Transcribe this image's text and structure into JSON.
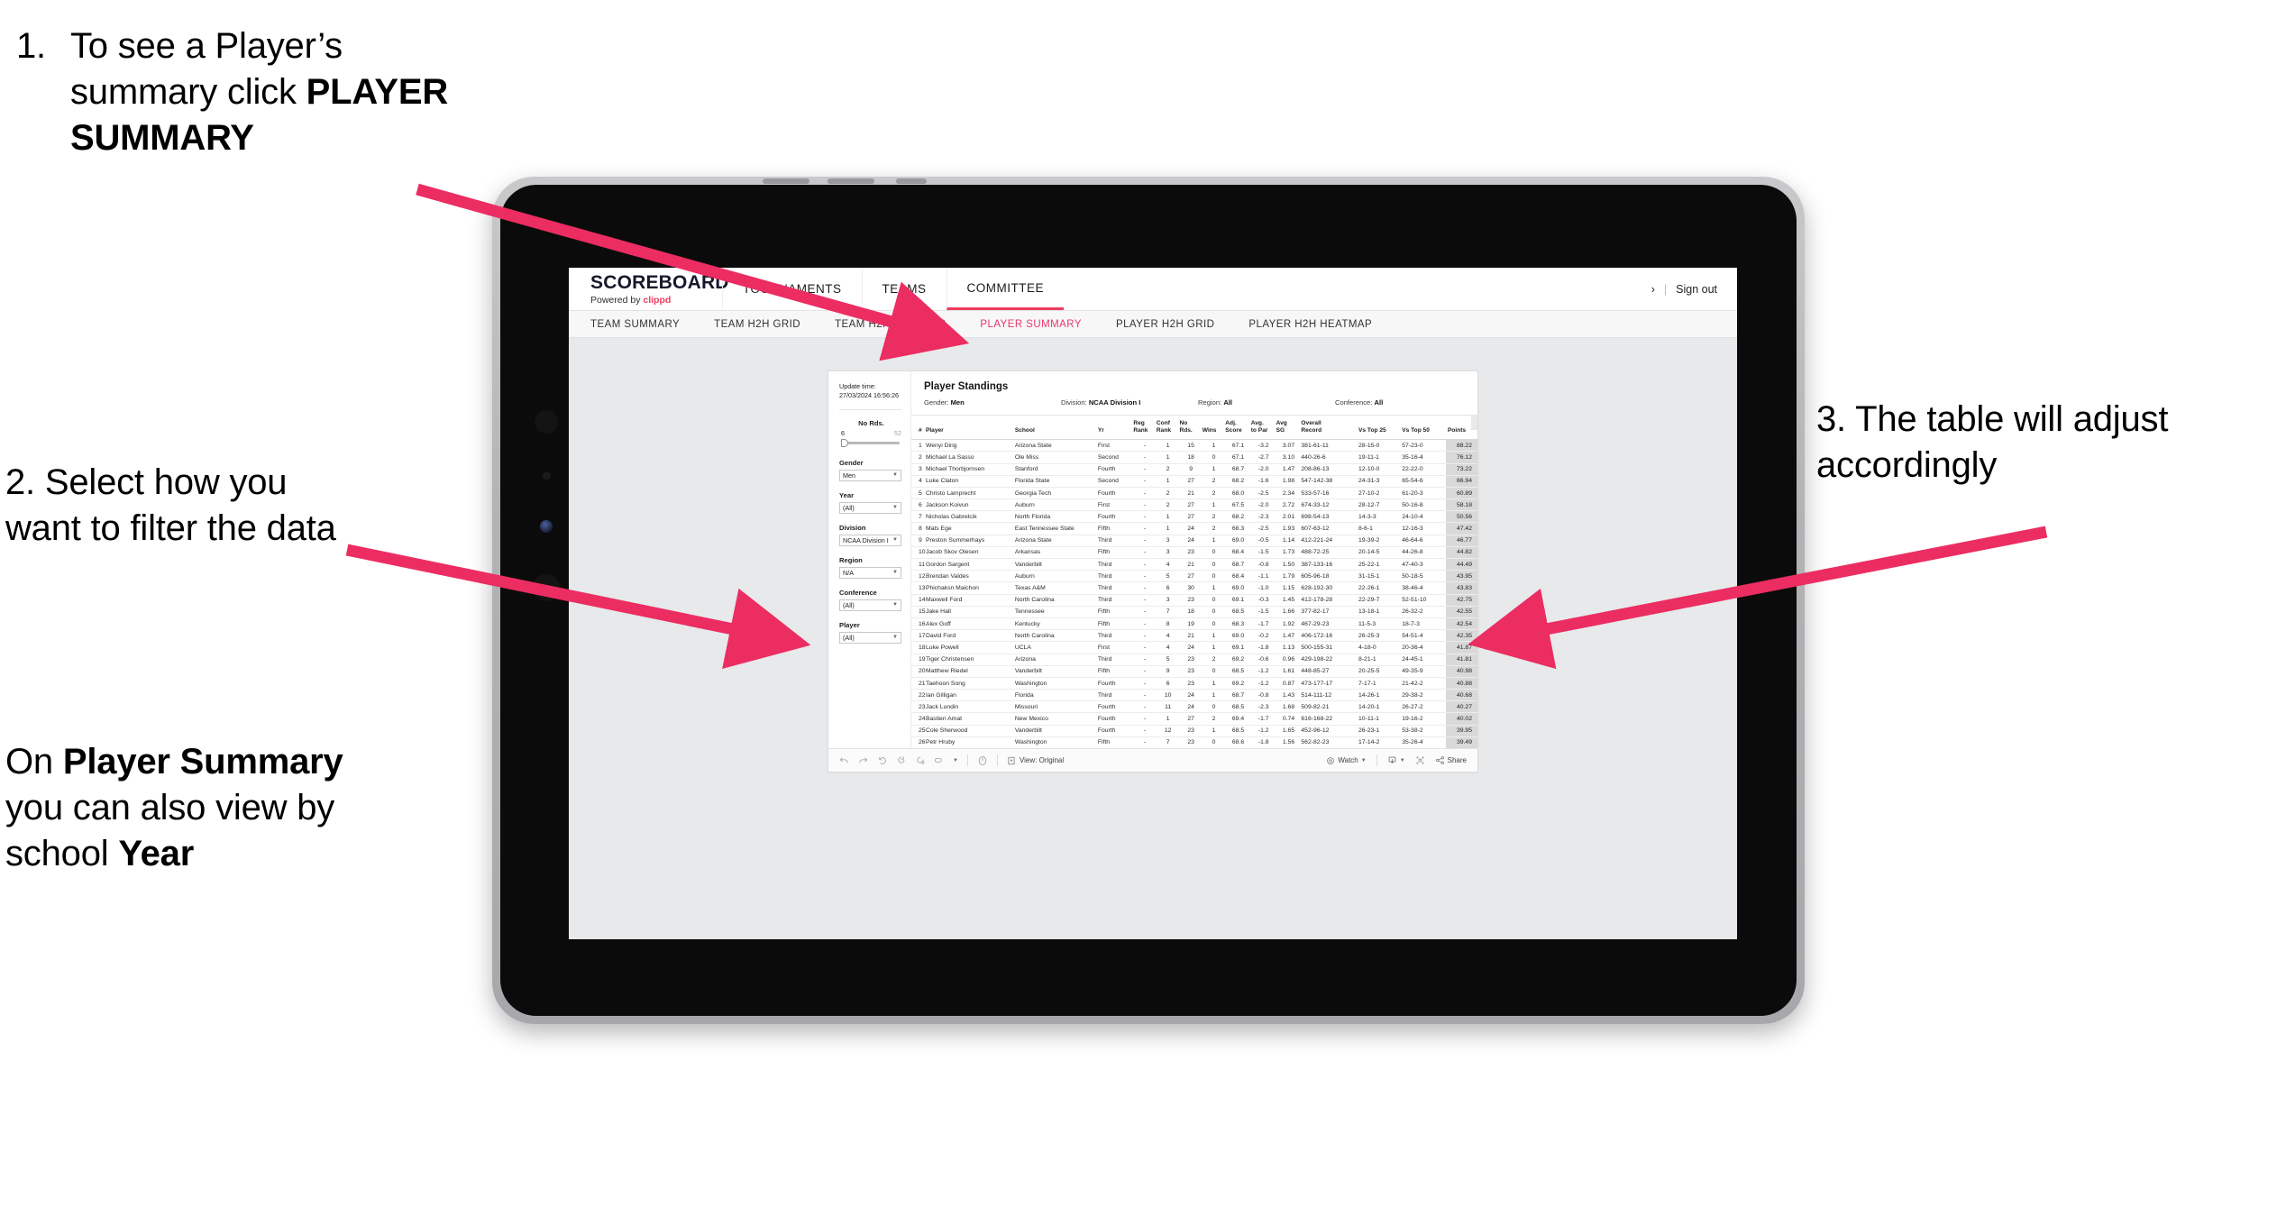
{
  "annotations": {
    "step1": {
      "number": "1.",
      "text_before": "To see a Player’s summary click ",
      "bold": "PLAYER SUMMARY"
    },
    "step2": {
      "text": "2. Select how you want to filter the data"
    },
    "step2b": {
      "before": "On ",
      "bold1": "Player Summary",
      "middle": " you can also view by school ",
      "bold2": "Year"
    },
    "step3": {
      "text": "3. The table will adjust accordingly"
    },
    "arrow_color": "#ec2d62"
  },
  "app": {
    "logo": {
      "title": "SCOREBOARD",
      "powered_prefix": "Powered by ",
      "brand": "clippd"
    },
    "top_tabs": [
      {
        "label": "TOURNAMENTS",
        "active": false
      },
      {
        "label": "TEAMS",
        "active": false
      },
      {
        "label": "COMMITTEE",
        "active": true
      }
    ],
    "header_right": {
      "chevron": "›",
      "separator": "|",
      "sign_out": "Sign out"
    },
    "sub_tabs": [
      {
        "label": "TEAM SUMMARY",
        "active": false
      },
      {
        "label": "TEAM H2H GRID",
        "active": false
      },
      {
        "label": "TEAM H2H HEATMAP",
        "active": false
      },
      {
        "label": "PLAYER SUMMARY",
        "active": true
      },
      {
        "label": "PLAYER H2H GRID",
        "active": false
      },
      {
        "label": "PLAYER H2H HEATMAP",
        "active": false
      }
    ],
    "accent_color": "#ee3b5f"
  },
  "filters": {
    "update_time_label": "Update time:",
    "update_time_value": "27/03/2024 16:56:26",
    "slider": {
      "label": "No Rds.",
      "min": "6",
      "max": "52"
    },
    "dropdowns": [
      {
        "label": "Gender",
        "value": "Men"
      },
      {
        "label": "Year",
        "value": "(All)"
      },
      {
        "label": "Division",
        "value": "NCAA Division I"
      },
      {
        "label": "Region",
        "value": "N/A"
      },
      {
        "label": "Conference",
        "value": "(All)"
      },
      {
        "label": "Player",
        "value": "(All)"
      }
    ]
  },
  "standings": {
    "title": "Player Standings",
    "summary": [
      {
        "label": "Gender:",
        "value": "Men"
      },
      {
        "label": "Division:",
        "value": "NCAA Division I"
      },
      {
        "label": "Region:",
        "value": "All"
      },
      {
        "label": "Conference:",
        "value": "All"
      }
    ],
    "columns": [
      {
        "key": "num",
        "l1": "#",
        "l2": ""
      },
      {
        "key": "player",
        "l1": "Player",
        "l2": ""
      },
      {
        "key": "school",
        "l1": "School",
        "l2": ""
      },
      {
        "key": "yr",
        "l1": "Yr",
        "l2": ""
      },
      {
        "key": "reg_rank",
        "l1": "Reg",
        "l2": "Rank"
      },
      {
        "key": "conf_rank",
        "l1": "Conf",
        "l2": "Rank"
      },
      {
        "key": "no_rds",
        "l1": "No",
        "l2": "Rds."
      },
      {
        "key": "wins",
        "l1": "Wins",
        "l2": ""
      },
      {
        "key": "adj_score",
        "l1": "Adj.",
        "l2": "Score"
      },
      {
        "key": "avg_par",
        "l1": "Avg.",
        "l2": "to Par"
      },
      {
        "key": "avg_sg",
        "l1": "Avg",
        "l2": "SG"
      },
      {
        "key": "overall",
        "l1": "Overall",
        "l2": "Record"
      },
      {
        "key": "t25",
        "l1": "Vs Top 25",
        "l2": ""
      },
      {
        "key": "t50",
        "l1": "Vs Top 50",
        "l2": ""
      },
      {
        "key": "points",
        "l1": "Points",
        "l2": ""
      }
    ],
    "rows": [
      {
        "num": "1",
        "player": "Wenyi Ding",
        "school": "Arizona State",
        "yr": "First",
        "reg_rank": "-",
        "conf_rank": "1",
        "no_rds": "15",
        "wins": "1",
        "adj_score": "67.1",
        "avg_par": "-3.2",
        "avg_sg": "3.07",
        "overall": "381-61-11",
        "t25": "28-15-0",
        "t50": "57-23-0",
        "points": "88.22"
      },
      {
        "num": "2",
        "player": "Michael La Sasso",
        "school": "Ole Miss",
        "yr": "Second",
        "reg_rank": "-",
        "conf_rank": "1",
        "no_rds": "18",
        "wins": "0",
        "adj_score": "67.1",
        "avg_par": "-2.7",
        "avg_sg": "3.10",
        "overall": "440-26-6",
        "t25": "19-11-1",
        "t50": "35-16-4",
        "points": "76.12"
      },
      {
        "num": "3",
        "player": "Michael Thorbjornsen",
        "school": "Stanford",
        "yr": "Fourth",
        "reg_rank": "-",
        "conf_rank": "2",
        "no_rds": "9",
        "wins": "1",
        "adj_score": "68.7",
        "avg_par": "-2.0",
        "avg_sg": "1.47",
        "overall": "208-86-13",
        "t25": "12-10-0",
        "t50": "22-22-0",
        "points": "73.22"
      },
      {
        "num": "4",
        "player": "Luke Claton",
        "school": "Florida State",
        "yr": "Second",
        "reg_rank": "-",
        "conf_rank": "1",
        "no_rds": "27",
        "wins": "2",
        "adj_score": "68.2",
        "avg_par": "-1.6",
        "avg_sg": "1.98",
        "overall": "547-142-38",
        "t25": "24-31-3",
        "t50": "65-54-6",
        "points": "66.94"
      },
      {
        "num": "5",
        "player": "Christo Lamprecht",
        "school": "Georgia Tech",
        "yr": "Fourth",
        "reg_rank": "-",
        "conf_rank": "2",
        "no_rds": "21",
        "wins": "2",
        "adj_score": "68.0",
        "avg_par": "-2.5",
        "avg_sg": "2.34",
        "overall": "533-57-16",
        "t25": "27-10-2",
        "t50": "61-20-3",
        "points": "60.89"
      },
      {
        "num": "6",
        "player": "Jackson Koivun",
        "school": "Auburn",
        "yr": "First",
        "reg_rank": "-",
        "conf_rank": "2",
        "no_rds": "27",
        "wins": "1",
        "adj_score": "67.5",
        "avg_par": "-2.0",
        "avg_sg": "2.72",
        "overall": "674-33-12",
        "t25": "28-12-7",
        "t50": "50-16-8",
        "points": "58.18"
      },
      {
        "num": "7",
        "player": "Nicholas Gabrelcik",
        "school": "North Florida",
        "yr": "Fourth",
        "reg_rank": "-",
        "conf_rank": "1",
        "no_rds": "27",
        "wins": "2",
        "adj_score": "68.2",
        "avg_par": "-2.3",
        "avg_sg": "2.01",
        "overall": "698-54-13",
        "t25": "14-3-3",
        "t50": "24-10-4",
        "points": "50.56"
      },
      {
        "num": "8",
        "player": "Mats Ege",
        "school": "East Tennessee State",
        "yr": "Fifth",
        "reg_rank": "-",
        "conf_rank": "1",
        "no_rds": "24",
        "wins": "2",
        "adj_score": "68.3",
        "avg_par": "-2.5",
        "avg_sg": "1.93",
        "overall": "607-63-12",
        "t25": "8-6-1",
        "t50": "12-16-3",
        "points": "47.42"
      },
      {
        "num": "9",
        "player": "Preston Summerhays",
        "school": "Arizona State",
        "yr": "Third",
        "reg_rank": "-",
        "conf_rank": "3",
        "no_rds": "24",
        "wins": "1",
        "adj_score": "69.0",
        "avg_par": "-0.5",
        "avg_sg": "1.14",
        "overall": "412-221-24",
        "t25": "19-39-2",
        "t50": "46-64-6",
        "points": "46.77"
      },
      {
        "num": "10",
        "player": "Jacob Skov Olesen",
        "school": "Arkansas",
        "yr": "Fifth",
        "reg_rank": "-",
        "conf_rank": "3",
        "no_rds": "23",
        "wins": "0",
        "adj_score": "68.4",
        "avg_par": "-1.5",
        "avg_sg": "1.73",
        "overall": "488-72-25",
        "t25": "20-14-5",
        "t50": "44-26-8",
        "points": "44.82"
      },
      {
        "num": "11",
        "player": "Gordon Sargent",
        "school": "Vanderbilt",
        "yr": "Third",
        "reg_rank": "-",
        "conf_rank": "4",
        "no_rds": "21",
        "wins": "0",
        "adj_score": "68.7",
        "avg_par": "-0.8",
        "avg_sg": "1.50",
        "overall": "387-133-16",
        "t25": "25-22-1",
        "t50": "47-40-3",
        "points": "44.49"
      },
      {
        "num": "12",
        "player": "Brendan Valdes",
        "school": "Auburn",
        "yr": "Third",
        "reg_rank": "-",
        "conf_rank": "5",
        "no_rds": "27",
        "wins": "0",
        "adj_score": "68.4",
        "avg_par": "-1.1",
        "avg_sg": "1.79",
        "overall": "605-96-18",
        "t25": "31-15-1",
        "t50": "50-18-5",
        "points": "43.95"
      },
      {
        "num": "13",
        "player": "Phichaksn Maichon",
        "school": "Texas A&M",
        "yr": "Third",
        "reg_rank": "-",
        "conf_rank": "6",
        "no_rds": "30",
        "wins": "1",
        "adj_score": "69.0",
        "avg_par": "-1.0",
        "avg_sg": "1.15",
        "overall": "628-192-30",
        "t25": "22-26-1",
        "t50": "38-46-4",
        "points": "43.83"
      },
      {
        "num": "14",
        "player": "Maxwell Ford",
        "school": "North Carolina",
        "yr": "Third",
        "reg_rank": "-",
        "conf_rank": "3",
        "no_rds": "23",
        "wins": "0",
        "adj_score": "69.1",
        "avg_par": "-0.3",
        "avg_sg": "1.45",
        "overall": "412-178-28",
        "t25": "22-29-7",
        "t50": "52-51-10",
        "points": "42.75"
      },
      {
        "num": "15",
        "player": "Jake Hall",
        "school": "Tennessee",
        "yr": "Fifth",
        "reg_rank": "-",
        "conf_rank": "7",
        "no_rds": "18",
        "wins": "0",
        "adj_score": "68.5",
        "avg_par": "-1.5",
        "avg_sg": "1.66",
        "overall": "377-82-17",
        "t25": "13-18-1",
        "t50": "26-32-2",
        "points": "42.55"
      },
      {
        "num": "16",
        "player": "Alex Goff",
        "school": "Kentucky",
        "yr": "Fifth",
        "reg_rank": "-",
        "conf_rank": "8",
        "no_rds": "19",
        "wins": "0",
        "adj_score": "68.3",
        "avg_par": "-1.7",
        "avg_sg": "1.92",
        "overall": "467-29-23",
        "t25": "11-5-3",
        "t50": "18-7-3",
        "points": "42.54"
      },
      {
        "num": "17",
        "player": "David Ford",
        "school": "North Carolina",
        "yr": "Third",
        "reg_rank": "-",
        "conf_rank": "4",
        "no_rds": "21",
        "wins": "1",
        "adj_score": "69.0",
        "avg_par": "-0.2",
        "avg_sg": "1.47",
        "overall": "406-172-16",
        "t25": "26-25-3",
        "t50": "54-51-4",
        "points": "42.35"
      },
      {
        "num": "18",
        "player": "Luke Powell",
        "school": "UCLA",
        "yr": "First",
        "reg_rank": "-",
        "conf_rank": "4",
        "no_rds": "24",
        "wins": "1",
        "adj_score": "69.1",
        "avg_par": "-1.8",
        "avg_sg": "1.13",
        "overall": "500-155-31",
        "t25": "4-18-0",
        "t50": "20-36-4",
        "points": "41.87"
      },
      {
        "num": "19",
        "player": "Tiger Christensen",
        "school": "Arizona",
        "yr": "Third",
        "reg_rank": "-",
        "conf_rank": "5",
        "no_rds": "23",
        "wins": "2",
        "adj_score": "69.2",
        "avg_par": "-0.6",
        "avg_sg": "0.96",
        "overall": "429-198-22",
        "t25": "8-21-1",
        "t50": "24-45-1",
        "points": "41.81"
      },
      {
        "num": "20",
        "player": "Matthew Riedel",
        "school": "Vanderbilt",
        "yr": "Fifth",
        "reg_rank": "-",
        "conf_rank": "9",
        "no_rds": "23",
        "wins": "0",
        "adj_score": "68.5",
        "avg_par": "-1.2",
        "avg_sg": "1.61",
        "overall": "448-85-27",
        "t25": "20-25-5",
        "t50": "49-35-9",
        "points": "40.98"
      },
      {
        "num": "21",
        "player": "Taehoon Song",
        "school": "Washington",
        "yr": "Fourth",
        "reg_rank": "-",
        "conf_rank": "6",
        "no_rds": "23",
        "wins": "1",
        "adj_score": "69.2",
        "avg_par": "-1.2",
        "avg_sg": "0.87",
        "overall": "473-177-17",
        "t25": "7-17-1",
        "t50": "21-42-2",
        "points": "40.88"
      },
      {
        "num": "22",
        "player": "Ian Gilligan",
        "school": "Florida",
        "yr": "Third",
        "reg_rank": "-",
        "conf_rank": "10",
        "no_rds": "24",
        "wins": "1",
        "adj_score": "68.7",
        "avg_par": "-0.8",
        "avg_sg": "1.43",
        "overall": "514-111-12",
        "t25": "14-26-1",
        "t50": "29-38-2",
        "points": "40.68"
      },
      {
        "num": "23",
        "player": "Jack Lundin",
        "school": "Missouri",
        "yr": "Fourth",
        "reg_rank": "-",
        "conf_rank": "11",
        "no_rds": "24",
        "wins": "0",
        "adj_score": "68.5",
        "avg_par": "-2.3",
        "avg_sg": "1.68",
        "overall": "509-82-21",
        "t25": "14-20-1",
        "t50": "26-27-2",
        "points": "40.27"
      },
      {
        "num": "24",
        "player": "Bastien Amat",
        "school": "New Mexico",
        "yr": "Fourth",
        "reg_rank": "-",
        "conf_rank": "1",
        "no_rds": "27",
        "wins": "2",
        "adj_score": "69.4",
        "avg_par": "-1.7",
        "avg_sg": "0.74",
        "overall": "616-168-22",
        "t25": "10-11-1",
        "t50": "19-16-2",
        "points": "40.02"
      },
      {
        "num": "25",
        "player": "Cole Sherwood",
        "school": "Vanderbilt",
        "yr": "Fourth",
        "reg_rank": "-",
        "conf_rank": "12",
        "no_rds": "23",
        "wins": "1",
        "adj_score": "68.5",
        "avg_par": "-1.2",
        "avg_sg": "1.65",
        "overall": "452-96-12",
        "t25": "26-23-1",
        "t50": "53-38-2",
        "points": "39.95"
      },
      {
        "num": "26",
        "player": "Petr Hruby",
        "school": "Washington",
        "yr": "Fifth",
        "reg_rank": "-",
        "conf_rank": "7",
        "no_rds": "23",
        "wins": "0",
        "adj_score": "68.6",
        "avg_par": "-1.8",
        "avg_sg": "1.56",
        "overall": "562-82-23",
        "t25": "17-14-2",
        "t50": "35-26-4",
        "points": "39.49"
      }
    ]
  },
  "toolbar": {
    "view_label": "View: Original",
    "watch_label": "Watch",
    "share_label": "Share"
  }
}
